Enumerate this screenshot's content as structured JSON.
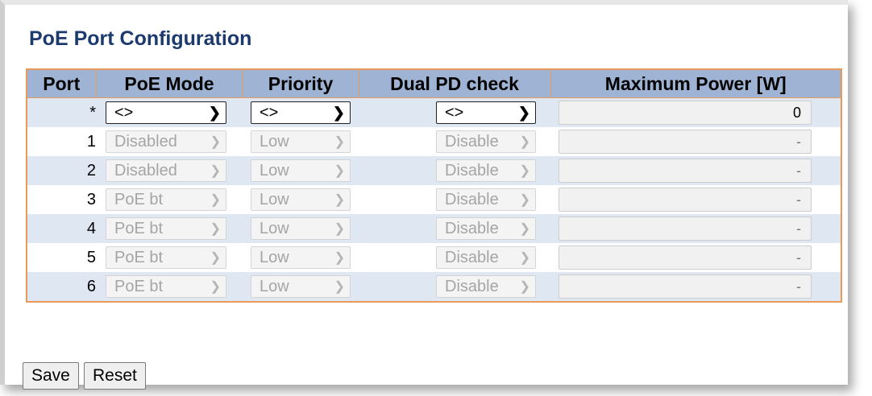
{
  "title": "PoE Port Configuration",
  "columns": [
    "Port",
    "PoE Mode",
    "Priority",
    "Dual PD check",
    "Maximum Power [W]"
  ],
  "global_row": {
    "port": "*",
    "poe_mode": "<>",
    "priority": "<>",
    "dual_pd": "<>",
    "max_power": "0"
  },
  "rows": [
    {
      "port": "1",
      "poe_mode": "Disabled",
      "priority": "Low",
      "dual_pd": "Disable",
      "max_power": "-"
    },
    {
      "port": "2",
      "poe_mode": "Disabled",
      "priority": "Low",
      "dual_pd": "Disable",
      "max_power": "-"
    },
    {
      "port": "3",
      "poe_mode": "PoE bt",
      "priority": "Low",
      "dual_pd": "Disable",
      "max_power": "-"
    },
    {
      "port": "4",
      "poe_mode": "PoE bt",
      "priority": "Low",
      "dual_pd": "Disable",
      "max_power": "-"
    },
    {
      "port": "5",
      "poe_mode": "PoE bt",
      "priority": "Low",
      "dual_pd": "Disable",
      "max_power": "-"
    },
    {
      "port": "6",
      "poe_mode": "PoE bt",
      "priority": "Low",
      "dual_pd": "Disable",
      "max_power": "-"
    }
  ],
  "buttons": {
    "save": "Save",
    "reset": "Reset"
  },
  "colors": {
    "header_bg": "#9fb3d4",
    "border": "#e89a5a",
    "title": "#1c3a6e",
    "row_alt": "#dfe7f3"
  }
}
